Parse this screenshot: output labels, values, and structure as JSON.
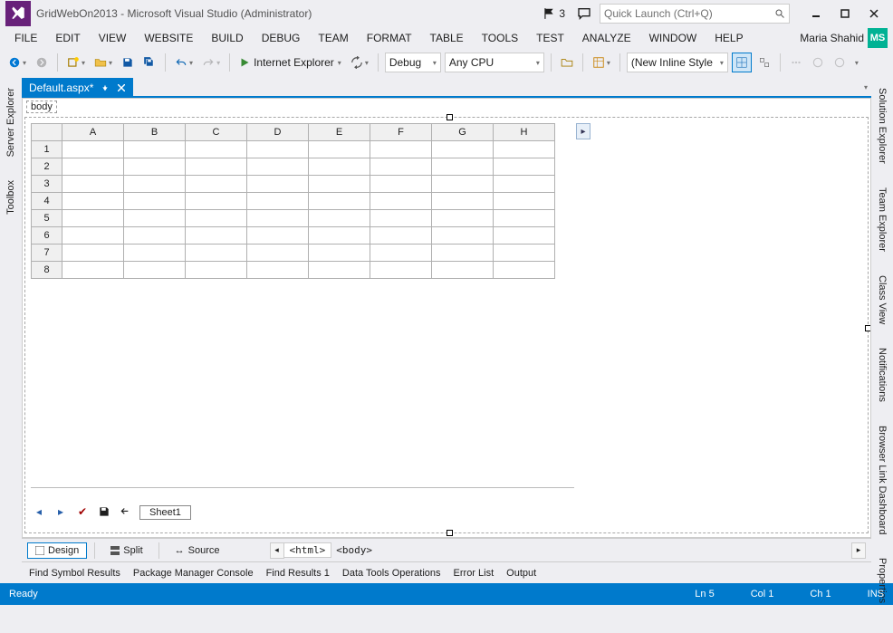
{
  "window": {
    "title": "GridWebOn2013 - Microsoft Visual Studio (Administrator)",
    "notification_count": "3",
    "user_name": "Maria Shahid",
    "user_initials": "MS",
    "quick_launch_placeholder": "Quick Launch (Ctrl+Q)"
  },
  "menu": {
    "file": "FILE",
    "edit": "EDIT",
    "view": "VIEW",
    "website": "WEBSITE",
    "build": "BUILD",
    "debug": "DEBUG",
    "team": "TEAM",
    "format": "FORMAT",
    "table": "TABLE",
    "tools": "TOOLS",
    "test": "TEST",
    "analyze": "ANALYZE",
    "window": "WINDOW",
    "help": "HELP"
  },
  "toolbar": {
    "start_label": "Internet Explorer",
    "config": "Debug",
    "platform": "Any CPU",
    "style": "(New Inline Style"
  },
  "doc": {
    "tab_title": "Default.aspx*",
    "body_label": "body",
    "columns": [
      "A",
      "B",
      "C",
      "D",
      "E",
      "F",
      "G",
      "H"
    ],
    "rows": [
      "1",
      "2",
      "3",
      "4",
      "5",
      "6",
      "7",
      "8"
    ],
    "sheet_name": "Sheet1"
  },
  "docfoot": {
    "design": "Design",
    "split": "Split",
    "source": "Source",
    "bc_html": "<html>",
    "bc_body": "<body>"
  },
  "panels": {
    "find_symbol": "Find Symbol Results",
    "pkg_console": "Package Manager Console",
    "find_results": "Find Results 1",
    "data_tools": "Data Tools Operations",
    "error_list": "Error List",
    "output": "Output"
  },
  "status": {
    "ready": "Ready",
    "ln": "Ln 5",
    "col": "Col 1",
    "ch": "Ch 1",
    "ins": "INS"
  },
  "left_rail": {
    "server_explorer": "Server Explorer",
    "toolbox": "Toolbox"
  },
  "right_rail": {
    "solution_explorer": "Solution Explorer",
    "team_explorer": "Team Explorer",
    "class_view": "Class View",
    "notifications": "Notifications",
    "browser_link": "Browser Link Dashboard",
    "properties": "Properties"
  }
}
